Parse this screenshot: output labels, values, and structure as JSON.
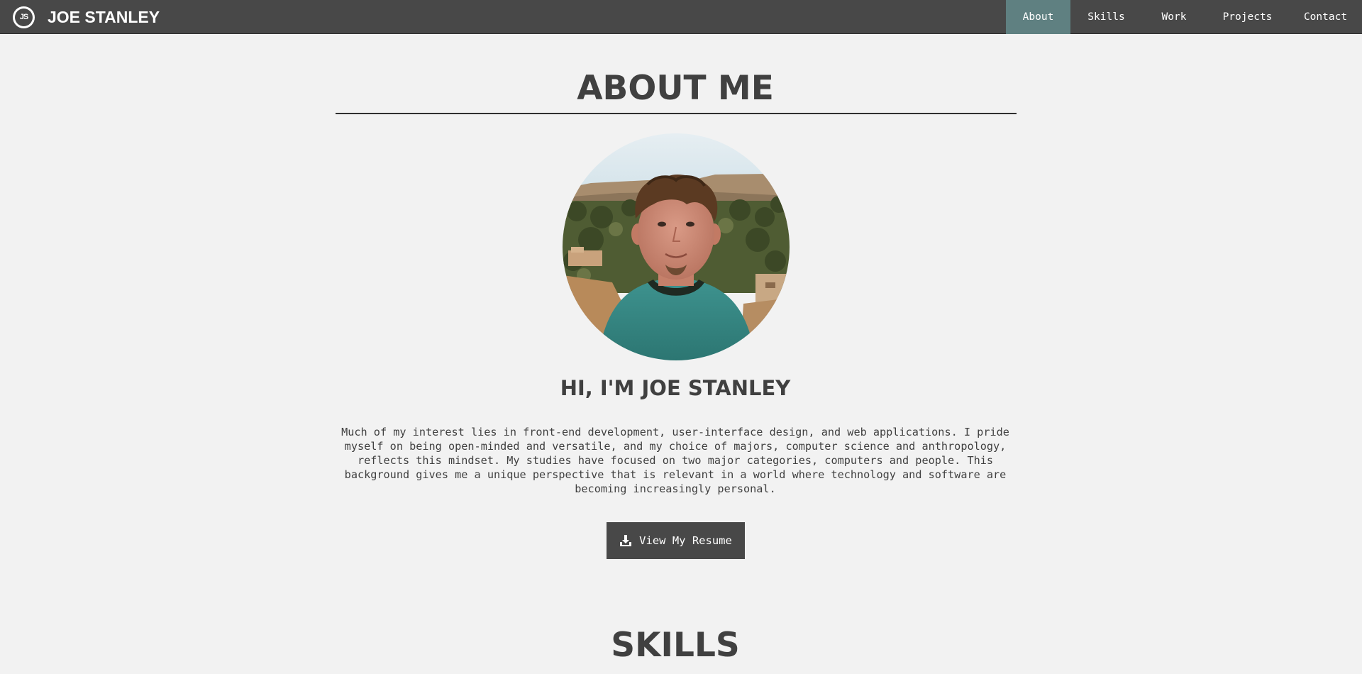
{
  "brand": {
    "logo_text": "JS",
    "name": "JOE STANLEY"
  },
  "nav": {
    "items": [
      {
        "label": "About",
        "active": true
      },
      {
        "label": "Skills",
        "active": false
      },
      {
        "label": "Work",
        "active": false
      },
      {
        "label": "Projects",
        "active": false
      },
      {
        "label": "Contact",
        "active": false
      }
    ]
  },
  "about": {
    "heading": "ABOUT ME",
    "greeting": "HI, I'M JOE STANLEY",
    "bio": "Much of my interest lies in front-end development, user-interface design, and web applications. I pride myself on being open-minded and versatile, and my choice of majors, computer science and anthropology, reflects this mindset. My studies have focused on two major categories, computers and people. This background gives me a unique perspective that is relevant in a world where technology and software are becoming increasingly personal.",
    "resume_button": "View My Resume"
  },
  "skills": {
    "heading": "SKILLS"
  },
  "colors": {
    "navbar_bg": "#484848",
    "nav_active_bg": "#5f8081",
    "page_bg": "#f2f2f2",
    "heading_text": "#404040",
    "button_bg": "#484848"
  },
  "icons": {
    "brand_logo": "js-monogram-icon",
    "resume_button": "download-icon"
  }
}
